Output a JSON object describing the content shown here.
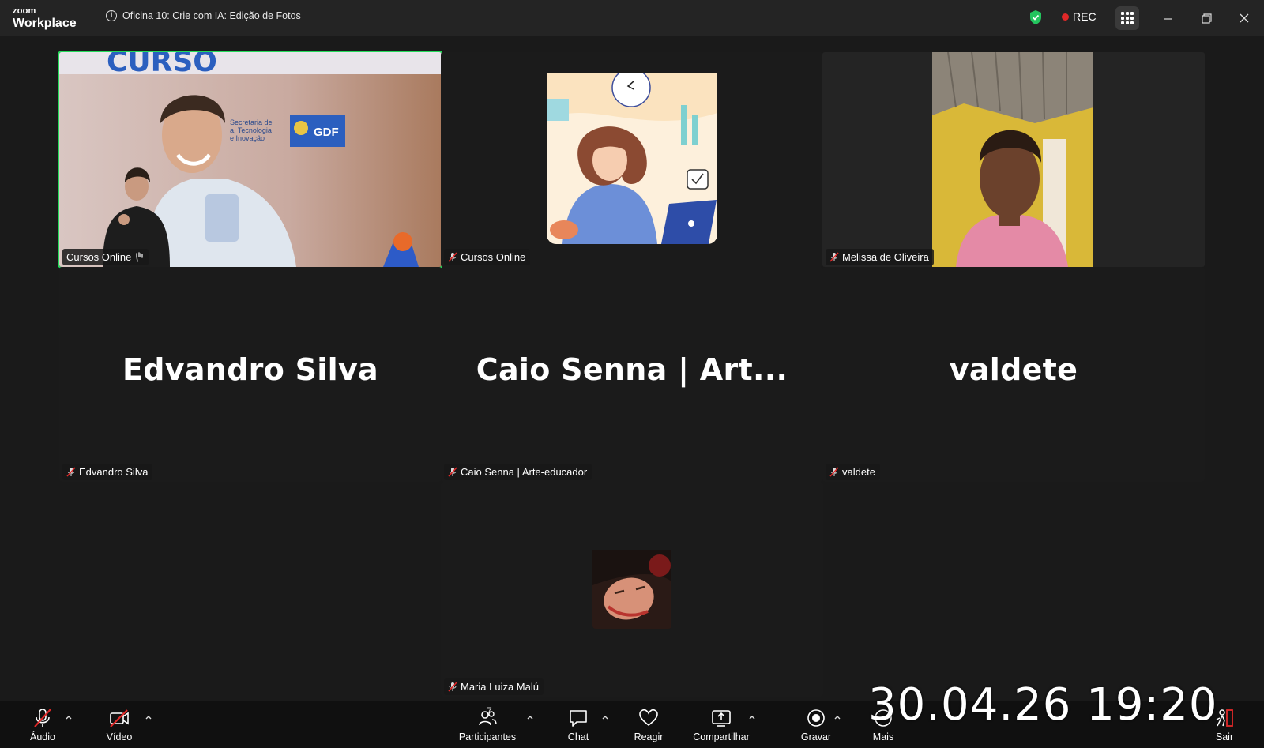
{
  "app": {
    "brand_small": "zoom",
    "brand": "Workplace"
  },
  "meeting": {
    "title": "Oficina 10: Crie com IA: Edição de Fotos",
    "rec_label": "REC"
  },
  "tiles": [
    {
      "name": "Cursos Online",
      "muted": false,
      "type": "video",
      "active": true
    },
    {
      "name": "Cursos Online",
      "muted": true,
      "type": "avatar"
    },
    {
      "name": "Melissa de Oliveira",
      "muted": true,
      "type": "video"
    },
    {
      "name": "Edvandro Silva",
      "display_name": "Edvandro Silva",
      "muted": true,
      "type": "name"
    },
    {
      "name": "Caio Senna | Arte-educador",
      "display_name": "Caio Senna | Art...",
      "muted": true,
      "type": "name"
    },
    {
      "name": "valdete",
      "display_name": "valdete",
      "muted": true,
      "type": "name"
    },
    {
      "name": "Maria Luiza Malú",
      "muted": true,
      "type": "avatar"
    }
  ],
  "toolbar": {
    "audio": "Áudio",
    "video": "Vídeo",
    "participants": "Participantes",
    "participants_count": "7",
    "chat": "Chat",
    "react": "Reagir",
    "share": "Compartilhar",
    "record": "Gravar",
    "more": "Mais",
    "leave": "Sair"
  },
  "overlay": {
    "timestamp": "30.04.26 19:20"
  },
  "colors": {
    "active_speaker": "#23d959",
    "rec": "#e02828",
    "leave": "#e02828",
    "muted": "#e02828"
  }
}
